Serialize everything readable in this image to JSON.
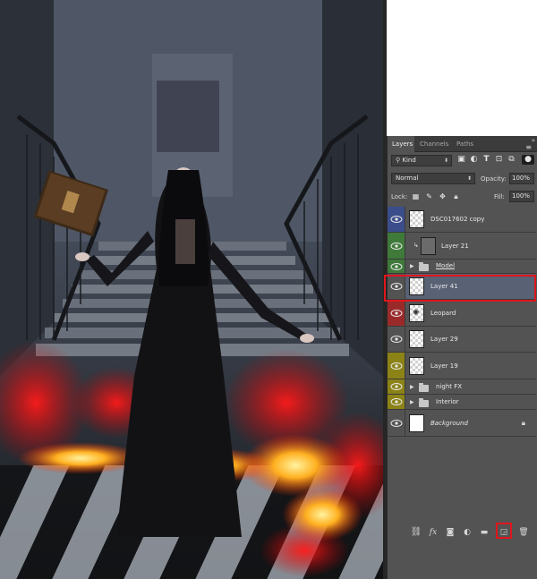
{
  "panel": {
    "tabs": [
      {
        "label": "Layers",
        "active": true
      },
      {
        "label": "Channels",
        "active": false
      },
      {
        "label": "Paths",
        "active": false
      }
    ],
    "menu_icon": "panel-menu-icon",
    "filter": {
      "kind_label": "Kind",
      "icons": [
        "image-filter-icon",
        "adjustment-filter-icon",
        "type-filter-icon",
        "shape-filter-icon",
        "smart-object-filter-icon"
      ]
    },
    "blend_mode": "Normal",
    "opacity": {
      "label": "Opacity:",
      "value": "100%"
    },
    "lock": {
      "label": "Lock:",
      "icons": [
        "lock-transparent-icon",
        "lock-image-icon",
        "lock-position-icon",
        "lock-all-icon"
      ]
    },
    "fill": {
      "label": "Fill:",
      "value": "100%"
    },
    "layers": [
      {
        "name": "DSC017602 copy",
        "color": "#3c4d8c",
        "type": "layer",
        "thumb": "transparent"
      },
      {
        "name": "Layer 21",
        "color": "#3f7a3a",
        "type": "layer-clipped",
        "thumb": "dark"
      },
      {
        "name": "Model",
        "color": "#3f7a3a",
        "type": "group",
        "underline": true
      },
      {
        "name": "Layer 41",
        "color": "#535353",
        "type": "layer",
        "thumb": "transparent",
        "selected": true
      },
      {
        "name": "Leopard",
        "color": "#9a2a2a",
        "type": "layer",
        "thumb": "transparent"
      },
      {
        "name": "Layer 29",
        "color": "#535353",
        "type": "layer",
        "thumb": "transparent"
      },
      {
        "name": "Layer 19",
        "color": "#8c8317",
        "type": "layer",
        "thumb": "transparent"
      },
      {
        "name": "night FX",
        "color": "#8c8317",
        "type": "group"
      },
      {
        "name": "Interior",
        "color": "#8c8317",
        "type": "group"
      },
      {
        "name": "Background",
        "color": "#535353",
        "type": "background",
        "thumb": "white",
        "italic": true,
        "locked": true
      }
    ],
    "footer_buttons": [
      "link-icon",
      "fx-icon",
      "mask-icon",
      "adjustment-icon",
      "folder-icon",
      "new-layer-icon",
      "trash-icon"
    ],
    "highlight_color": "#e0151c"
  }
}
